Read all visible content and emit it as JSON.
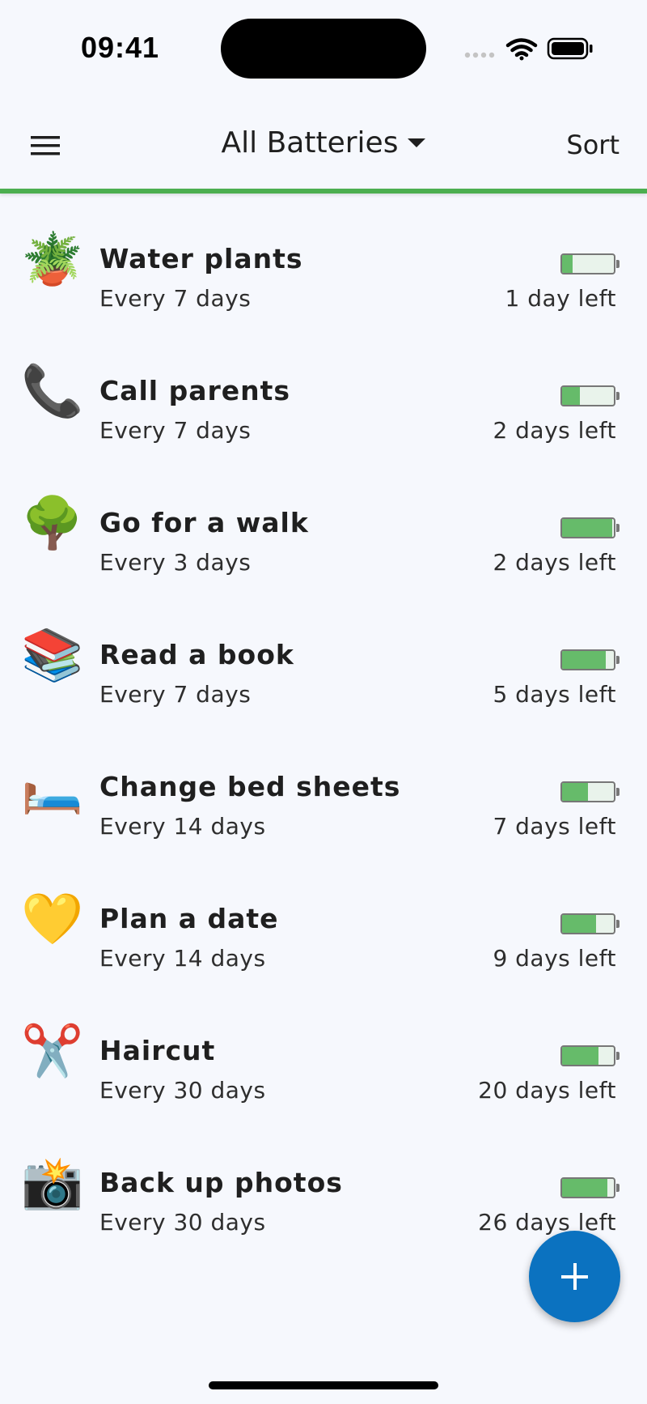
{
  "status_bar": {
    "time": "09:41"
  },
  "app_bar": {
    "title": "All Batteries",
    "sort_label": "Sort",
    "menu_icon": "hamburger-menu-icon",
    "dropdown_icon": "caret-down-icon"
  },
  "colors": {
    "accent": "#4caf50",
    "battery_fill": "#66bb6a",
    "fab": "#0b72c0",
    "background": "#f6f8fd"
  },
  "batteries": [
    {
      "emoji": "🪴",
      "name": "Water plants",
      "frequency": "Every 7 days",
      "remaining": "1 day left",
      "charge": 0.2
    },
    {
      "emoji": "📞",
      "name": "Call parents",
      "frequency": "Every 7 days",
      "remaining": "2 days left",
      "charge": 0.35
    },
    {
      "emoji": "🌳",
      "name": "Go for a walk",
      "frequency": "Every 3 days",
      "remaining": "2 days left",
      "charge": 0.97
    },
    {
      "emoji": "📚",
      "name": "Read a book",
      "frequency": "Every 7 days",
      "remaining": "5 days left",
      "charge": 0.85
    },
    {
      "emoji": "🛏️",
      "name": "Change bed sheets",
      "frequency": "Every 14 days",
      "remaining": "7 days left",
      "charge": 0.5
    },
    {
      "emoji": "💛",
      "name": "Plan a date",
      "frequency": "Every 14 days",
      "remaining": "9 days left",
      "charge": 0.66
    },
    {
      "emoji": "✂️",
      "name": "Haircut",
      "frequency": "Every 30 days",
      "remaining": "20 days left",
      "charge": 0.7
    },
    {
      "emoji": "📸",
      "name": "Back up photos",
      "frequency": "Every 30 days",
      "remaining": "26 days left",
      "charge": 0.88
    }
  ],
  "fab": {
    "icon": "plus-icon"
  }
}
